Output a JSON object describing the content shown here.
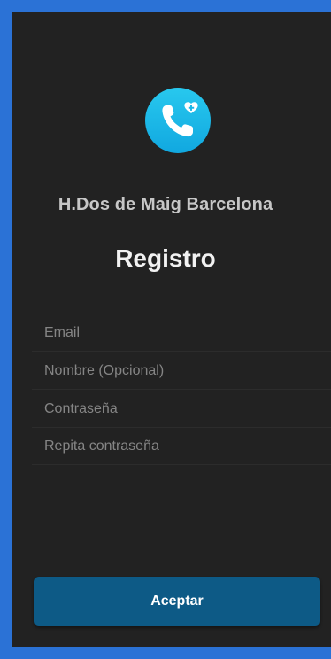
{
  "app": {
    "hospital_name": "H.Dos de Maig Barcelona",
    "logo_icon": "phone-heart-icon",
    "logo_color": "#1bb8e8"
  },
  "form": {
    "title": "Registro",
    "fields": [
      {
        "name": "email",
        "placeholder": "Email",
        "value": ""
      },
      {
        "name": "nombre",
        "placeholder": "Nombre (Opcional)",
        "value": ""
      },
      {
        "name": "contrasena",
        "placeholder": "Contraseña",
        "value": ""
      },
      {
        "name": "repita-contrasena",
        "placeholder": "Repita contraseña",
        "value": ""
      }
    ],
    "submit_label": "Aceptar"
  },
  "colors": {
    "frame": "#2b72d6",
    "background": "#222222",
    "button": "#0d5a86"
  }
}
